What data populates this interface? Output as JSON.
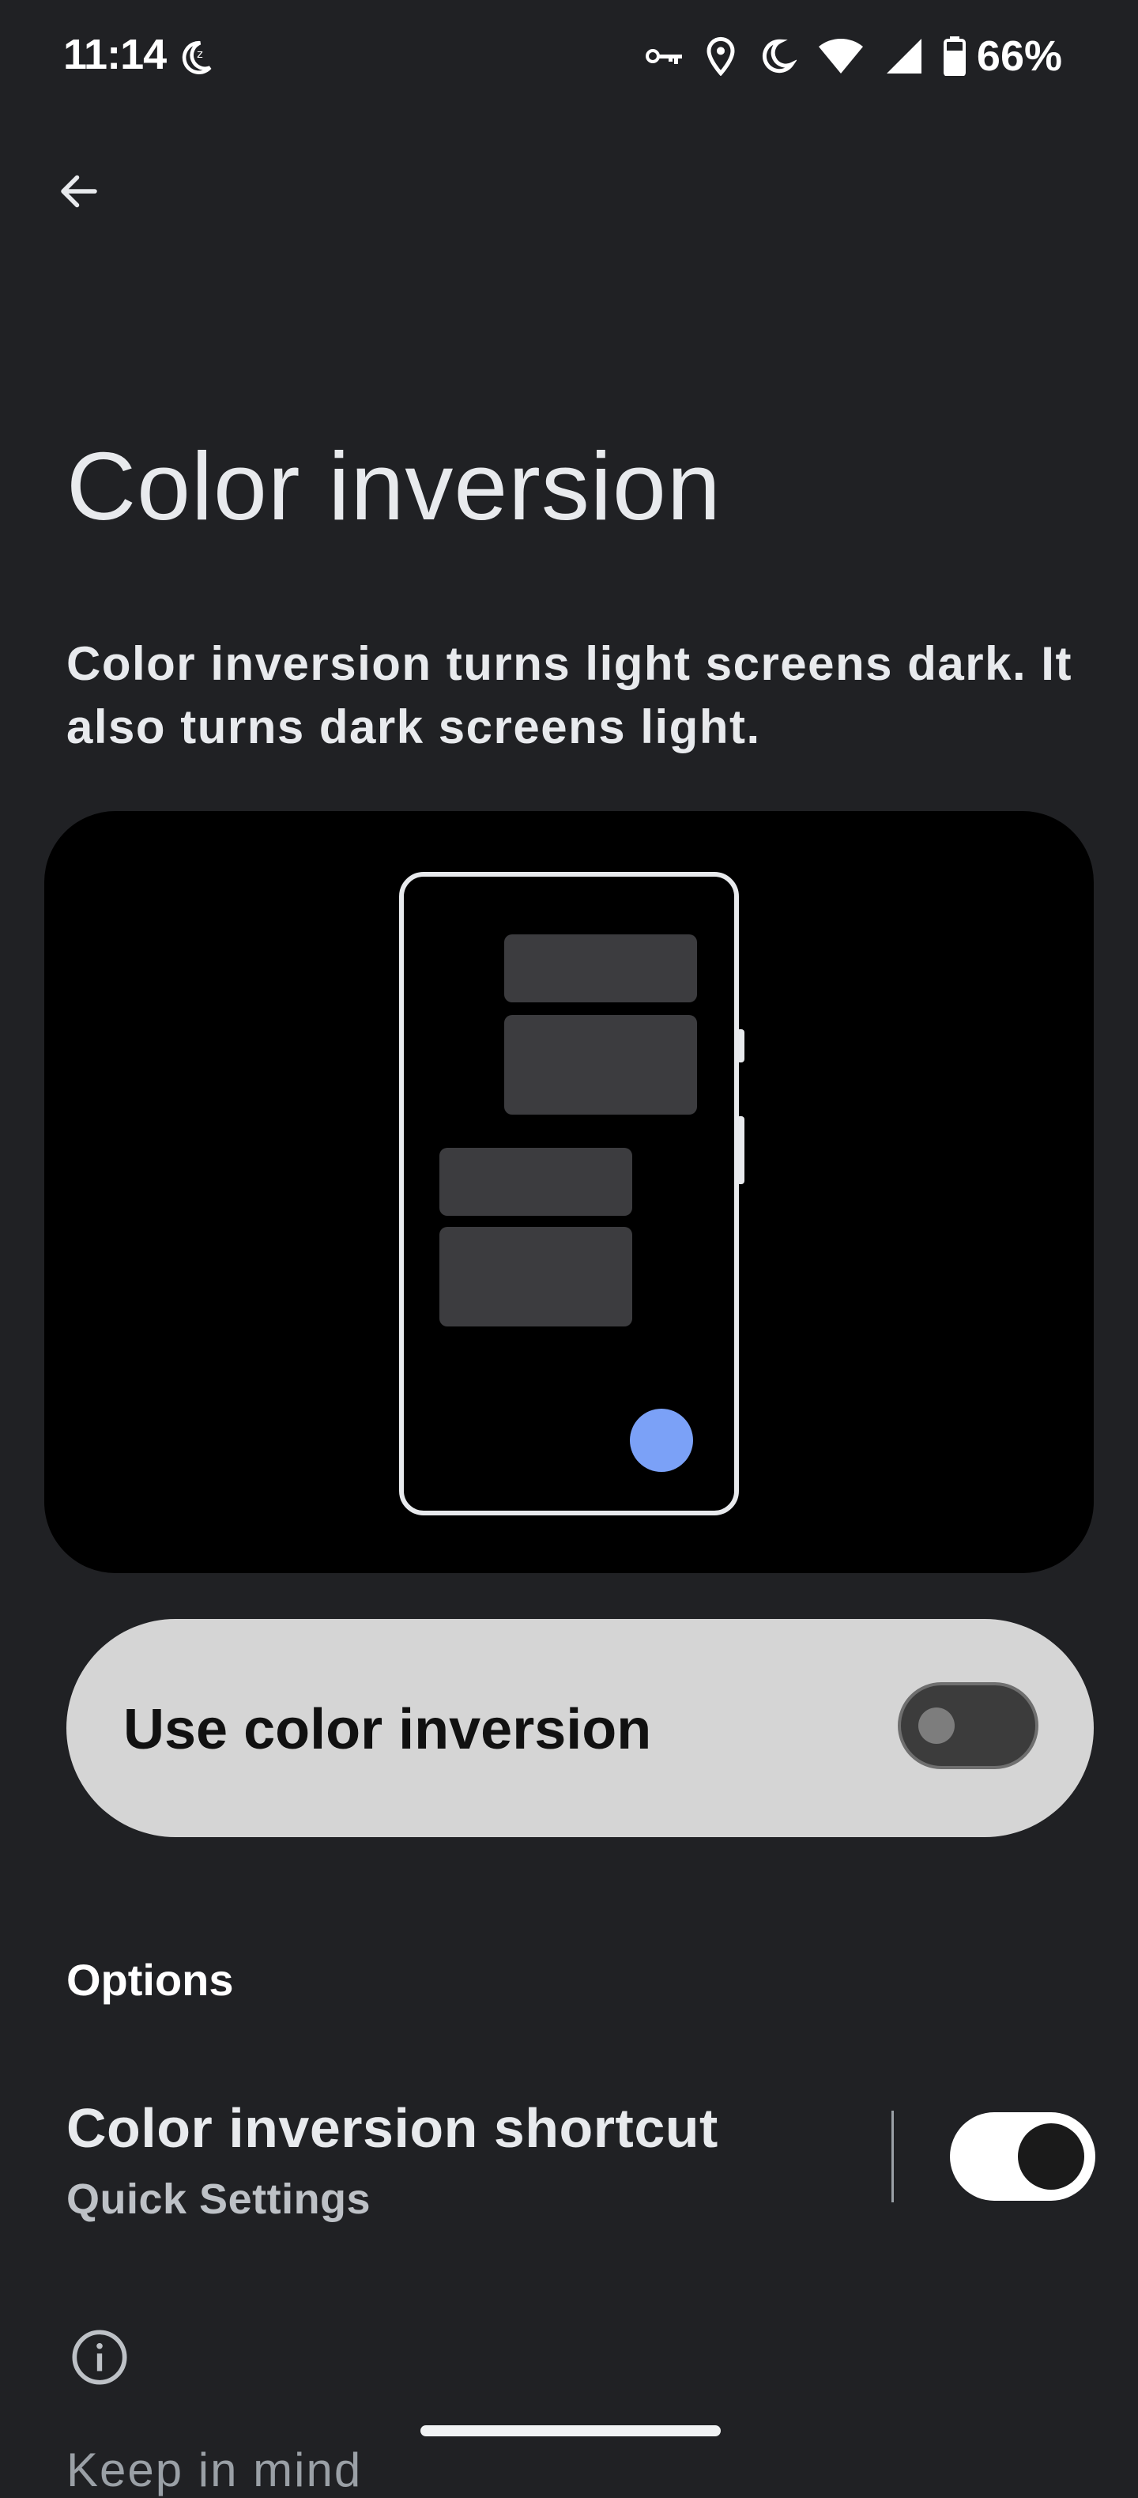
{
  "status_bar": {
    "time": "11:14",
    "battery_percent": "66%",
    "icons": [
      "do-not-disturb-moon-icon",
      "vpn-key-icon",
      "location-icon",
      "moon-icon",
      "wifi-icon",
      "cell-signal-icon",
      "battery-icon"
    ]
  },
  "header": {
    "back_icon": "arrow-left-icon"
  },
  "page": {
    "title": "Color inversion",
    "description": "Color inversion turns light screens dark. It also turns dark screens light."
  },
  "main_switch": {
    "label": "Use color inversion",
    "checked": false
  },
  "options": {
    "header": "Options",
    "shortcut": {
      "title": "Color inversion shortcut",
      "summary": "Quick Settings",
      "checked": true
    }
  },
  "footer": {
    "info_icon": "info-icon",
    "peek_text": "Keep in mind"
  },
  "colors": {
    "background": "#202124",
    "accent_blue": "#7ba1f7",
    "card_light": "#d5d5d5"
  }
}
